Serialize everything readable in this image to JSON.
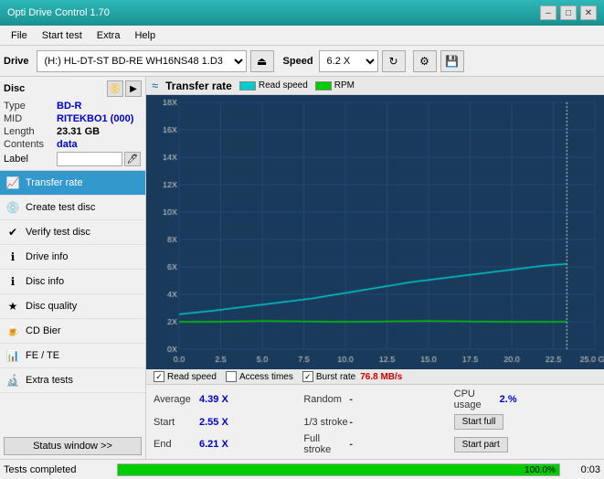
{
  "app": {
    "title": "Opti Drive Control 1.70",
    "titlebar_controls": [
      "–",
      "□",
      "✕"
    ]
  },
  "menu": {
    "items": [
      "File",
      "Start test",
      "Extra",
      "Help"
    ]
  },
  "toolbar": {
    "drive_label": "Drive",
    "drive_value": "(H:)  HL-DT-ST BD-RE  WH16NS48 1.D3",
    "speed_label": "Speed",
    "speed_value": "6.2 X"
  },
  "disc": {
    "title": "Disc",
    "type_label": "Type",
    "type_value": "BD-R",
    "mid_label": "MID",
    "mid_value": "RITEKBO1 (000)",
    "length_label": "Length",
    "length_value": "23.31 GB",
    "contents_label": "Contents",
    "contents_value": "data",
    "label_label": "Label",
    "label_value": ""
  },
  "nav": {
    "items": [
      {
        "id": "transfer-rate",
        "label": "Transfer rate",
        "active": true
      },
      {
        "id": "create-test-disc",
        "label": "Create test disc",
        "active": false
      },
      {
        "id": "verify-test-disc",
        "label": "Verify test disc",
        "active": false
      },
      {
        "id": "drive-info",
        "label": "Drive info",
        "active": false
      },
      {
        "id": "disc-info",
        "label": "Disc info",
        "active": false
      },
      {
        "id": "disc-quality",
        "label": "Disc quality",
        "active": false
      },
      {
        "id": "cd-bier",
        "label": "CD Bier",
        "active": false
      },
      {
        "id": "fe-te",
        "label": "FE / TE",
        "active": false
      },
      {
        "id": "extra-tests",
        "label": "Extra tests",
        "active": false
      }
    ],
    "status_window_btn": "Status window >>"
  },
  "chart": {
    "title": "Transfer rate",
    "legend": [
      {
        "id": "read-speed",
        "label": "Read speed",
        "color": "#00cccc"
      },
      {
        "id": "rpm",
        "label": "RPM",
        "color": "#00cc00"
      }
    ],
    "y_axis": [
      "18X",
      "16X",
      "14X",
      "12X",
      "10X",
      "8X",
      "6X",
      "4X",
      "2X",
      "0.0"
    ],
    "x_axis": [
      "0.0",
      "2.5",
      "5.0",
      "7.5",
      "10.0",
      "12.5",
      "15.0",
      "17.5",
      "20.0",
      "22.5",
      "25.0 GB"
    ]
  },
  "legend_row": {
    "read_speed_checked": true,
    "read_speed_label": "Read speed",
    "access_times_checked": false,
    "access_times_label": "Access times",
    "burst_rate_checked": true,
    "burst_rate_label": "Burst rate",
    "burst_rate_value": "76.8 MB/s"
  },
  "stats": {
    "average_label": "Average",
    "average_value": "4.39 X",
    "random_label": "Random",
    "random_value": "-",
    "cpu_usage_label": "CPU usage",
    "cpu_usage_value": "2.%",
    "start_label": "Start",
    "start_value": "2.55 X",
    "one_third_label": "1/3 stroke",
    "one_third_value": "-",
    "start_full_btn": "Start full",
    "end_label": "End",
    "end_value": "6.21 X",
    "full_stroke_label": "Full stroke",
    "full_stroke_value": "-",
    "start_part_btn": "Start part"
  },
  "status_bar": {
    "text": "Tests completed",
    "progress": 100,
    "progress_label": "100.0%",
    "timer": "0:03"
  }
}
